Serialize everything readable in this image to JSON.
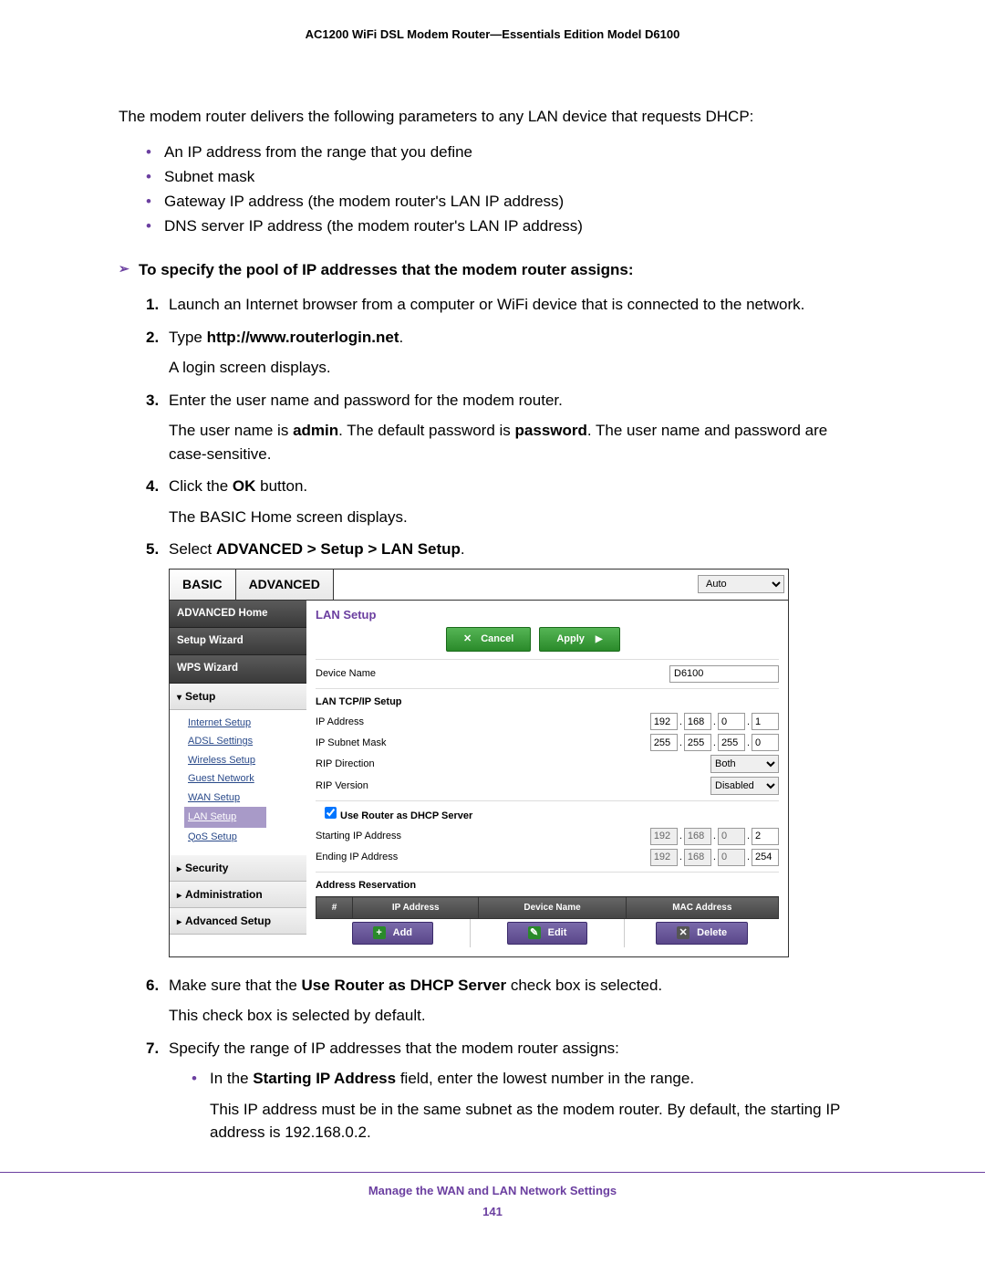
{
  "header": {
    "title": "AC1200 WiFi DSL Modem Router—Essentials Edition Model D6100"
  },
  "intro": "The modem router delivers the following parameters to any LAN device that requests DHCP:",
  "bullets": [
    "An IP address from the range that you define",
    "Subnet mask",
    "Gateway IP address (the modem router's LAN IP address)",
    "DNS server IP address (the modem router's LAN IP address)"
  ],
  "arrow_heading": "To specify the pool of IP addresses that the modem router assigns:",
  "steps": {
    "s1": "Launch an Internet browser from a computer or WiFi device that is connected to the network.",
    "s2_pre": "Type ",
    "s2_b": "http://www.routerlogin.net",
    "s2_post": ".",
    "s2_sub": "A login screen displays.",
    "s3": "Enter the user name and password for the modem router.",
    "s3_p1": "The user name is ",
    "s3_b1": "admin",
    "s3_p2": ". The default password is ",
    "s3_b2": "password",
    "s3_p3": ". The user name and password are case-sensitive.",
    "s4_pre": "Click the ",
    "s4_b": "OK",
    "s4_post": " button.",
    "s4_sub": "The BASIC Home screen displays.",
    "s5_pre": "Select ",
    "s5_b": "ADVANCED > Setup > LAN Setup",
    "s5_post": ".",
    "s6_pre": "Make sure that the ",
    "s6_b": "Use Router as DHCP Server",
    "s6_post": " check box is selected.",
    "s6_sub": "This check box is selected by default.",
    "s7": "Specify the range of IP addresses that the modem router assigns:",
    "s7_b1_pre": "In the ",
    "s7_b1_b": "Starting IP Address",
    "s7_b1_post": " field, enter the lowest number in the range.",
    "s7_b1_sub": "This IP address must be in the same subnet as the modem router. By default, the starting IP address is 192.168.0.2."
  },
  "router_ui": {
    "tabs": {
      "basic": "BASIC",
      "advanced": "ADVANCED"
    },
    "auto": "Auto",
    "side": {
      "adv_home": "ADVANCED Home",
      "setup_wizard": "Setup Wizard",
      "wps_wizard": "WPS Wizard",
      "setup": "Setup",
      "internet_setup": "Internet Setup",
      "adsl_settings": "ADSL Settings",
      "wireless_setup": "Wireless Setup",
      "guest_network": "Guest Network",
      "wan_setup": "WAN Setup",
      "lan_setup": "LAN Setup",
      "qos_setup": "QoS Setup",
      "security": "Security",
      "administration": "Administration",
      "advanced_setup": "Advanced Setup"
    },
    "main": {
      "title": "LAN Setup",
      "cancel": "Cancel",
      "apply": "Apply",
      "device_name_label": "Device Name",
      "device_name": "D6100",
      "lan_tcpip": "LAN TCP/IP Setup",
      "ip_address_label": "IP Address",
      "ip_address": [
        "192",
        "168",
        "0",
        "1"
      ],
      "subnet_label": "IP Subnet Mask",
      "subnet": [
        "255",
        "255",
        "255",
        "0"
      ],
      "rip_dir_label": "RIP Direction",
      "rip_dir": "Both",
      "rip_ver_label": "RIP Version",
      "rip_ver": "Disabled",
      "use_dhcp": "Use Router as DHCP Server",
      "start_ip_label": "Starting IP Address",
      "start_ip": [
        "192",
        "168",
        "0",
        "2"
      ],
      "end_ip_label": "Ending IP Address",
      "end_ip": [
        "192",
        "168",
        "0",
        "254"
      ],
      "addr_res": "Address Reservation",
      "th_num": "#",
      "th_ip": "IP Address",
      "th_dev": "Device Name",
      "th_mac": "MAC Address",
      "btn_add": "Add",
      "btn_edit": "Edit",
      "btn_delete": "Delete"
    }
  },
  "footer": {
    "title": "Manage the WAN and LAN Network Settings",
    "page": "141"
  }
}
